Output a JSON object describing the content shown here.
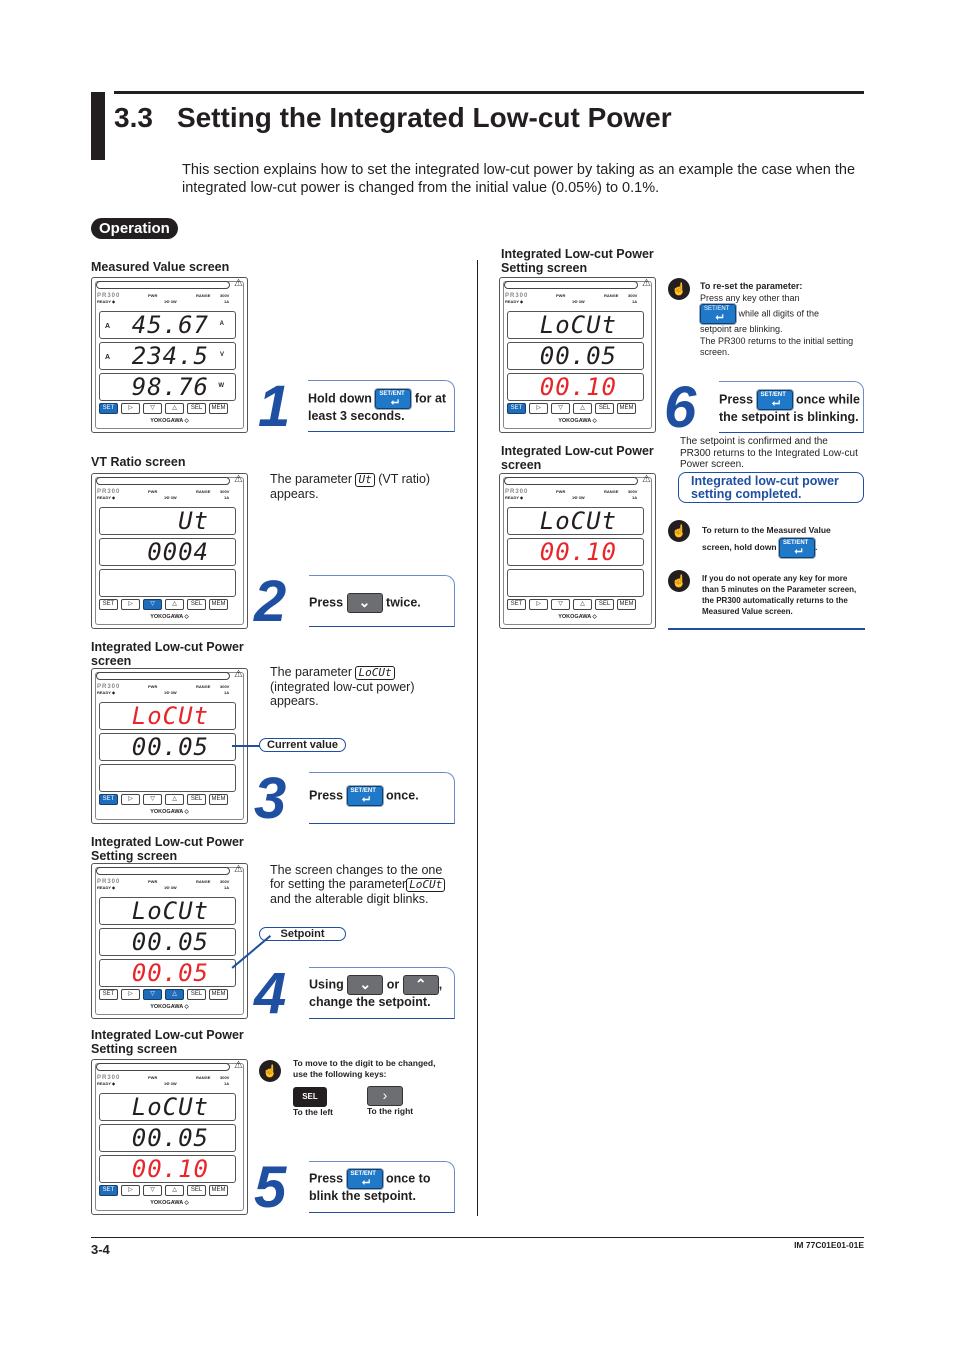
{
  "header": {
    "section_number": "3.3",
    "title": "Setting the Integrated Low-cut Power"
  },
  "intro": "This section explains how to set the integrated low-cut power by taking as an example the case when the integrated low-cut power is changed from the initial value (0.05%) to 0.1%.",
  "operation_label": "Operation",
  "device": {
    "brand": "PR300",
    "logo": "YOKOGAWA ◇",
    "warning": "⚠",
    "labels": {
      "pwr": "PWR",
      "range": "RANGE",
      "volt": "300V",
      "ready": "READY ◆",
      "wiring": "1Φ 3W",
      "amp": "1A"
    },
    "keys": [
      "SET/ENT",
      "▷",
      "▽",
      "△",
      "SEL",
      "MEM/ADR"
    ]
  },
  "screens": [
    {
      "caption": "Measured Value screen",
      "rows": [
        {
          "v": "45.67",
          "lab": "A",
          "unit": "A"
        },
        {
          "v": "234.5",
          "lab": "A",
          "unit": "V"
        },
        {
          "v": "98.76",
          "unit": "W"
        }
      ],
      "on": [
        0
      ]
    },
    {
      "caption": "VT Ratio screen",
      "rows": [
        {
          "v": "Ut"
        },
        {
          "v": "0004"
        },
        {
          "v": ""
        }
      ],
      "on": [
        2
      ]
    },
    {
      "caption": "Integrated Low-cut Power screen",
      "rows": [
        {
          "v": "LoCUt",
          "red": true
        },
        {
          "v": "00.05"
        },
        {
          "v": ""
        }
      ],
      "on": [
        0
      ]
    },
    {
      "caption": "Integrated Low-cut Power Setting screen",
      "rows": [
        {
          "v": "LoCUt"
        },
        {
          "v": "00.05"
        },
        {
          "v": "00.05",
          "red": true
        }
      ],
      "on": [
        2,
        3
      ]
    },
    {
      "caption": "Integrated Low-cut Power Setting screen",
      "rows": [
        {
          "v": "LoCUt"
        },
        {
          "v": "00.05"
        },
        {
          "v": "00.10",
          "red": true
        }
      ],
      "on": [
        0
      ]
    },
    {
      "caption": "Integrated Low-cut Power Setting screen",
      "rows": [
        {
          "v": "LoCUt"
        },
        {
          "v": "00.05"
        },
        {
          "v": "00.10",
          "red": true
        }
      ],
      "on": [
        0
      ]
    },
    {
      "caption": "Integrated Low-cut Power screen",
      "rows": [
        {
          "v": "LoCUt"
        },
        {
          "v": "00.10",
          "red": true
        },
        {
          "v": ""
        }
      ],
      "on": []
    }
  ],
  "steps": [
    {
      "num": "1",
      "a": "Hold down",
      "b": "for at",
      "c": "least 3 seconds."
    },
    {
      "num": "2",
      "a": "Press",
      "b": "twice."
    },
    {
      "num": "3",
      "a": "Press",
      "b": "once."
    },
    {
      "num": "4",
      "a": "Using",
      "or": "or",
      "b": ",",
      "c": "change the setpoint."
    },
    {
      "num": "5",
      "a": "Press",
      "b": "once to",
      "c": "blink the setpoint."
    },
    {
      "num": "6",
      "a": "Press",
      "b": "once while",
      "c": "the setpoint is blinking."
    }
  ],
  "paras": {
    "vt_a": "The parameter",
    "vt_param": "Ut",
    "vt_b": "(VT ratio)",
    "vt_c": "appears.",
    "lc_a": "The parameter",
    "lc_param": "LoCUt",
    "lc_b": "(integrated low-cut power)",
    "lc_c": "appears.",
    "sc_a": "The screen changes to the one",
    "sc_b": "for setting the parameter",
    "sc_param": "LoCUt",
    "sc_c": "and the alterable digit blinks.",
    "confirm": "The setpoint is confirmed and the PR300 returns to the Integrated Low-cut Power screen."
  },
  "pills": {
    "current": "Current value",
    "setpoint": "Setpoint",
    "completed": "Integrated low-cut power setting completed."
  },
  "notes": {
    "move_a": "To move to the digit to be changed,",
    "move_b": "use the following keys:",
    "sel": "SEL",
    "left": "To the left",
    "right": "To the right",
    "reset_title": "To re-set the parameter:",
    "reset_a": "Press any key other than",
    "reset_b": "while all digits of the",
    "reset_c": "setpoint are blinking.",
    "reset_d": "The PR300 returns to the initial setting screen.",
    "return_a": "To return to the Measured Value",
    "return_b": "screen, hold down",
    "return_c": ".",
    "timeout": "If you do not operate any key for more than 5 minutes on the Parameter screen, the PR300 automatically returns to the Measured Value screen."
  },
  "setkey": {
    "top": "SET/ENT",
    "glyph": "⮠"
  },
  "footer": {
    "page": "3-4",
    "doc_id": "IM 77C01E01-01E"
  },
  "colors": {
    "accent": "#1f4fa0",
    "key_blue": "#1f78c8",
    "blink_red": "#e8262a"
  }
}
